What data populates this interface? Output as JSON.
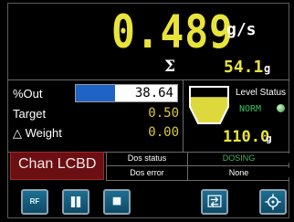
{
  "flow": {
    "value": "0.489",
    "unit": "g/s"
  },
  "total": {
    "symbol": "Σ",
    "value": "54.1",
    "unit": "g"
  },
  "parameters": {
    "out_label": "%Out",
    "out_value": "38.64",
    "out_fraction": 0.39,
    "target_label": "Target",
    "target_value": "0.50",
    "weight_label": "△ Weight",
    "weight_value": "0.00"
  },
  "level": {
    "title": "Level Status",
    "state": "NORM",
    "weight": "110.0",
    "unit": "g",
    "fill_fraction": 0.72
  },
  "status": {
    "channel": "Chan LCBD",
    "dos_status_label": "Dos status",
    "dos_status_value": "DOSING",
    "dos_error_label": "Dos error",
    "dos_error_value": "None"
  },
  "controls": {
    "rf_label": "RF",
    "pause_icon": "pause-icon",
    "stop_icon": "stop-icon",
    "swap_icon": "swap-icon",
    "target_icon": "target-icon"
  },
  "colors": {
    "value_yellow": "#e9e43a",
    "status_green": "#42b462",
    "channel_red": "#6c0f12",
    "out_blue": "#1f63c6",
    "button_blue": "#126483"
  }
}
